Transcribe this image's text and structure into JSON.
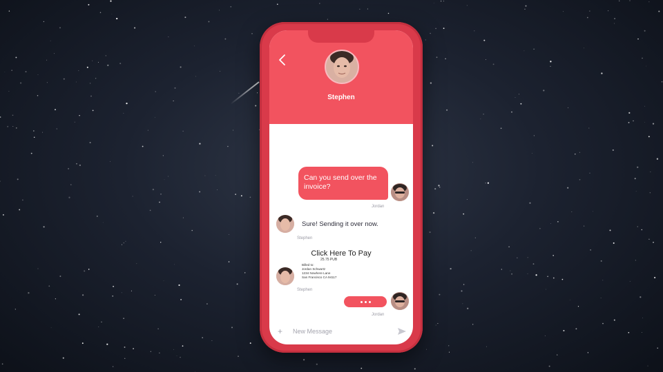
{
  "header": {
    "contact_name": "Stephen",
    "back_icon": "back-chevron-icon"
  },
  "colors": {
    "accent": "#f2535f",
    "phone_frame": "#d93a4a",
    "background": "#1c2230"
  },
  "messages": [
    {
      "text": "Can you send over the invoice?",
      "sender": "Jordan"
    },
    {
      "text": "Sure! Sending it over now.",
      "sender": "Stephen"
    }
  ],
  "invoice": {
    "title": "Click Here To Pay",
    "amount": "25.75 PUB",
    "billed_to_label": "Billed to:",
    "name": "Jordan Schwartz",
    "street": "1234 Nowhere Lane",
    "city": "San Francisco CA 94117",
    "sender": "Stephen"
  },
  "typing": {
    "sender": "Jordan"
  },
  "composer": {
    "placeholder": "New Message",
    "add_icon": "plus-icon",
    "send_icon": "send-icon"
  }
}
